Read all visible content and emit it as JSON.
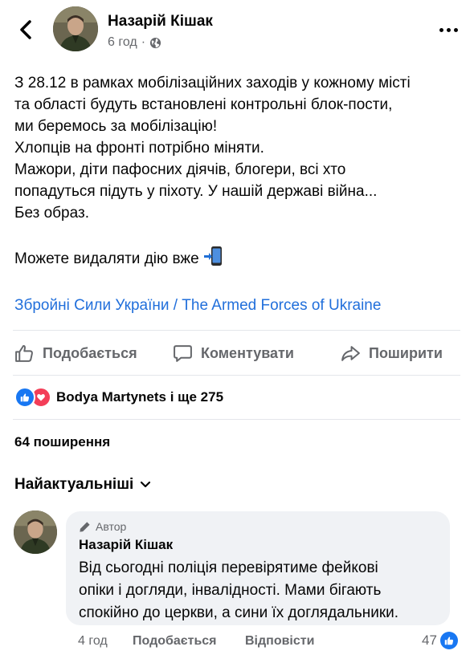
{
  "post": {
    "author": "Назарій Кішак",
    "time": "6 год",
    "meta_separator": "·",
    "lines": [
      "З 28.12 в рамках мобілізаційних заходів у кожному місті",
      "та області будуть встановлені контрольні блок-пости,",
      "ми беремось за мобілізацію!",
      "Хлопців на фронті потрібно міняти.",
      "Мажори, діти пафосних діячів, блогери, всі хто",
      "попадуться підуть у піхоту. У нашій державі війна...",
      "Без образ."
    ],
    "last_line": "Можете видаляти дію вже",
    "page_link": "Збройні Сили України / The Armed Forces of Ukraine"
  },
  "actions": {
    "like": "Подобається",
    "comment": "Коментувати",
    "share": "Поширити"
  },
  "reactions": {
    "summary": "Bodya Martynets і ще 275"
  },
  "shares": "64 поширення",
  "sort_label": "Найактуальніші",
  "comment": {
    "badge": "Автор",
    "author": "Назарій Кішак",
    "lines": [
      "Від сьогодні поліція перевірятиме  фейкові",
      "опіки і догляди, інвалідності. Мами бігають",
      "спокійно до церкви, а сини їх доглядальники."
    ],
    "time": "4 год",
    "like": "Подобається",
    "reply": "Відповісти",
    "reaction_count": "47"
  },
  "colors": {
    "link": "#216fdb",
    "like_blue": "#1877f2",
    "love_red": "#f33e58",
    "muted": "#65676b",
    "bubble": "#f0f2f5"
  },
  "icons": [
    "back-arrow-icon",
    "globe-icon",
    "more-icon",
    "mobile-phone-arrow-icon",
    "thumbs-up-icon",
    "comment-icon",
    "share-icon",
    "heart-icon",
    "chevron-down-icon",
    "pencil-icon"
  ]
}
